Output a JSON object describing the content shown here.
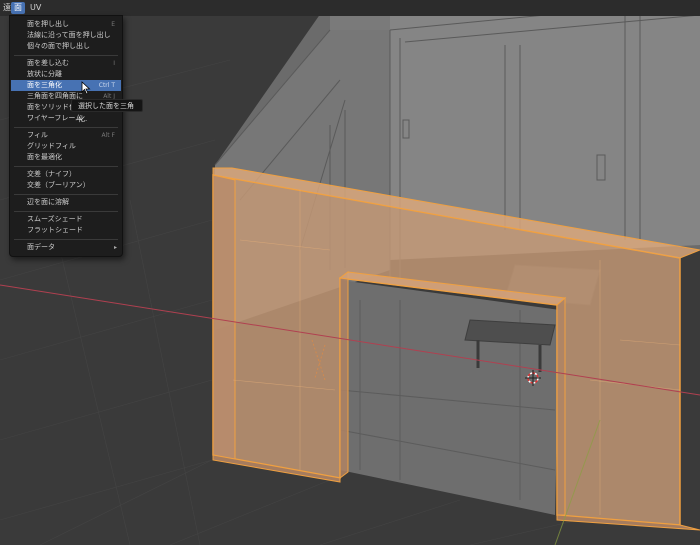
{
  "menubar": {
    "left_partial": "遠",
    "face_menu": "面",
    "uv_menu": "UV"
  },
  "face_menu": {
    "groups": [
      [
        {
          "label": "面を押し出し",
          "shortcut": "E"
        },
        {
          "label": "法線に沿って面を押し出し",
          "shortcut": ""
        },
        {
          "label": "個々の面で押し出し",
          "shortcut": ""
        }
      ],
      [
        {
          "label": "面を差し込む",
          "shortcut": "I"
        },
        {
          "label": "放状に分離",
          "shortcut": ""
        },
        {
          "label": "面を三角化",
          "shortcut": "Ctrl T"
        },
        {
          "label": "三角面を四角面に",
          "shortcut": "Alt J"
        },
        {
          "label": "面をソリッド化",
          "shortcut": ""
        },
        {
          "label": "ワイヤーフレーム",
          "shortcut": ""
        }
      ],
      [
        {
          "label": "フィル",
          "shortcut": "Alt F"
        },
        {
          "label": "グリッドフィル",
          "shortcut": ""
        },
        {
          "label": "面を最適化",
          "shortcut": ""
        }
      ],
      [
        {
          "label": "交差（ナイフ）",
          "shortcut": ""
        },
        {
          "label": "交差（ブーリアン）",
          "shortcut": ""
        }
      ],
      [
        {
          "label": "辺を面に溶解",
          "shortcut": ""
        }
      ],
      [
        {
          "label": "スムーズシェード",
          "shortcut": ""
        },
        {
          "label": "フラットシェード",
          "shortcut": ""
        }
      ],
      [
        {
          "label": "面データ",
          "shortcut": ""
        }
      ]
    ],
    "highlighted": "面を三角化",
    "submenu_arrow": "▸"
  },
  "tooltip": {
    "text": "選択した面を三角化."
  },
  "colors": {
    "viewport_bg": "#3a3a3a",
    "menu_bg": "#1d1d1d",
    "highlight": "#4772b3",
    "selection_orange": "#f0a040",
    "x_axis": "#b04050",
    "y_axis": "#8aa040"
  },
  "icons": [
    "cursor-arrow-icon",
    "3d-cursor-icon",
    "submenu-arrow-icon"
  ]
}
